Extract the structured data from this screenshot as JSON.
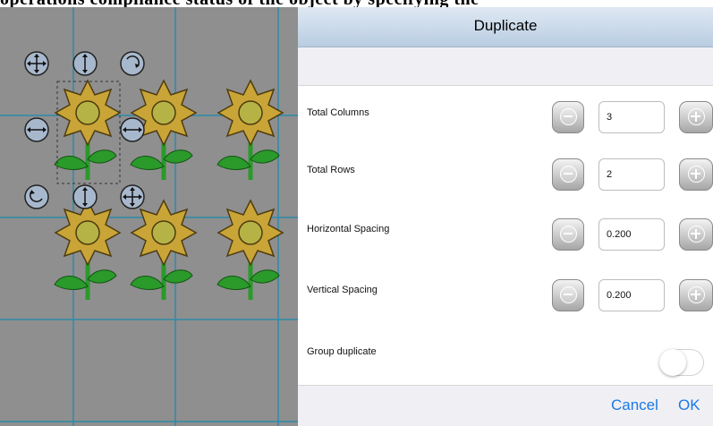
{
  "page": {
    "top_caption": "operations compliance status of the object by specifying the"
  },
  "canvas": {
    "background": "#8f8f8f",
    "grid_color": "#2b8ca8",
    "handle_icons": [
      "move-icon",
      "vertical-resize-icon",
      "rotate-icon",
      "horizontal-resize-icon",
      "horizontal-resize-icon",
      "rotate-icon",
      "vertical-resize-icon",
      "move-icon"
    ],
    "flower_count": 6,
    "petal_color": "#c9a437",
    "center_color": "#b6b346",
    "leaf_color": "#2a9a2a"
  },
  "dialog": {
    "title": "Duplicate",
    "rows": [
      {
        "label": "Total Columns",
        "value": "3"
      },
      {
        "label": "Total Rows",
        "value": "2"
      },
      {
        "label": "Horizontal Spacing",
        "value": "0.200"
      },
      {
        "label": "Vertical Spacing",
        "value": "0.200"
      }
    ],
    "group_duplicate": {
      "label": "Group duplicate",
      "on": false
    },
    "cancel_label": "Cancel",
    "ok_label": "OK",
    "accent": "#1a79e6"
  }
}
